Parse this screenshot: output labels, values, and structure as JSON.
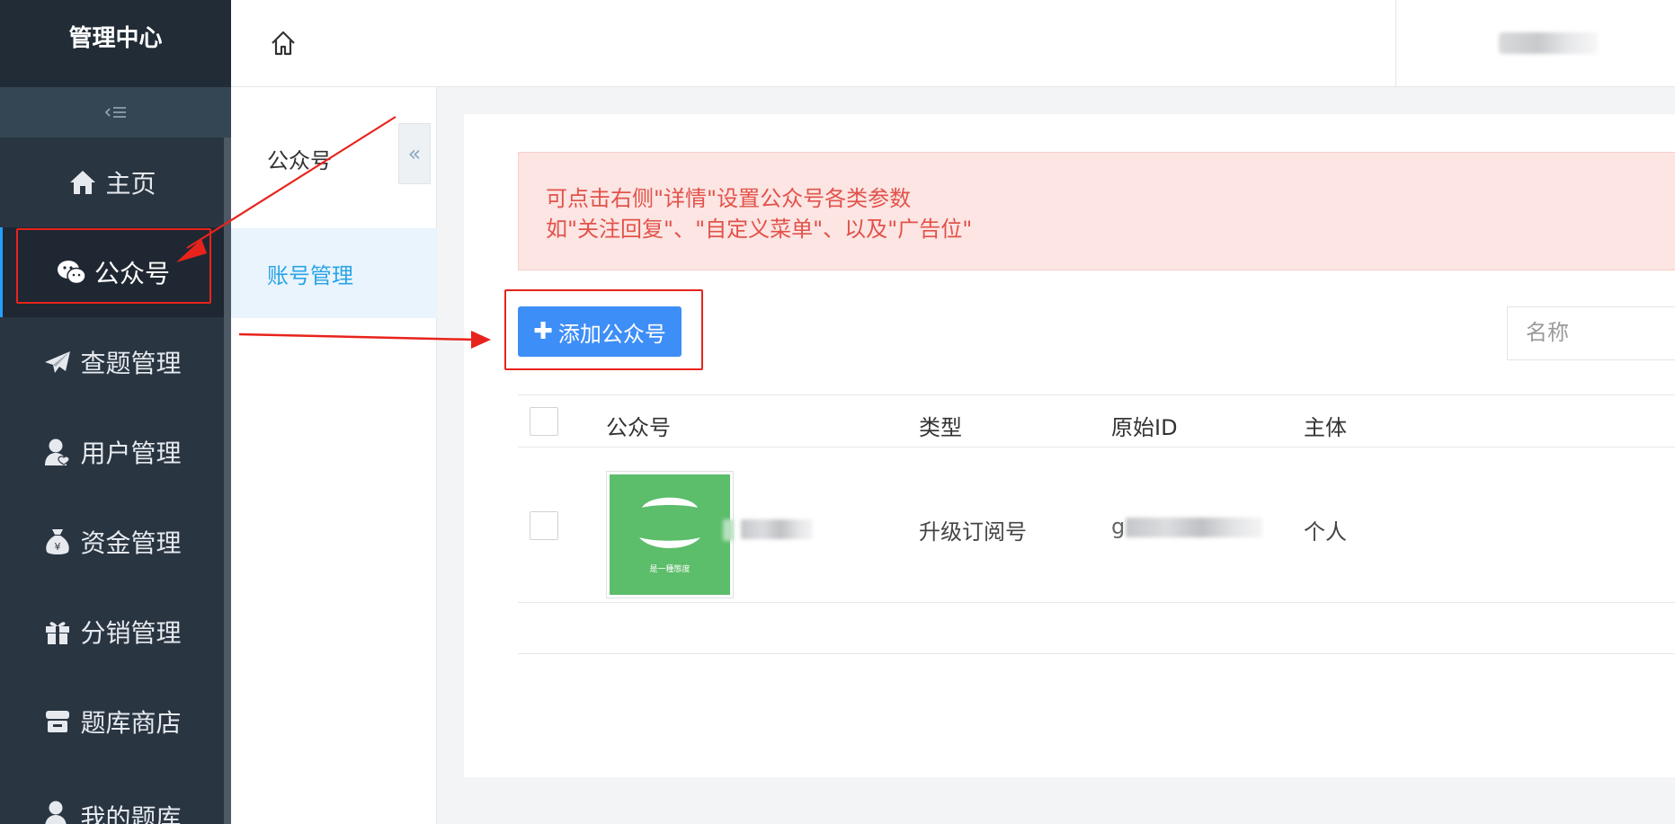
{
  "sidebar": {
    "brand": "管理中心",
    "items": [
      {
        "label": "主页",
        "icon": "home-icon"
      },
      {
        "label": "公众号",
        "icon": "wechat-icon",
        "active": true
      },
      {
        "label": "查题管理",
        "icon": "paper-plane-icon"
      },
      {
        "label": "用户管理",
        "icon": "user-icon"
      },
      {
        "label": "资金管理",
        "icon": "money-bag-icon"
      },
      {
        "label": "分销管理",
        "icon": "gift-icon"
      },
      {
        "label": "题库商店",
        "icon": "store-icon"
      },
      {
        "label": "我的题库",
        "icon": "user-icon"
      }
    ]
  },
  "subnav": {
    "title": "公众号",
    "items": [
      {
        "label": "账号管理",
        "active": true
      }
    ]
  },
  "alert": {
    "line1": "可点击右侧\"详情\"设置公众号各类参数",
    "line2": "如\"关注回复\"、\"自定义菜单\"、以及\"广告位\""
  },
  "toolbar": {
    "add_label": "添加公众号",
    "search_placeholder": "名称"
  },
  "table": {
    "columns": [
      "公众号",
      "类型",
      "原始ID",
      "主体"
    ],
    "rows": [
      {
        "name": "",
        "type": "升级订阅号",
        "original_id": "g",
        "subject": "个人",
        "avatar_caption": "是一種態度"
      }
    ]
  },
  "colors": {
    "sidebar_bg": "#2a3542",
    "accent": "#3e8ef7",
    "alert_text": "#e2524a",
    "annotation": "#e8231c"
  }
}
